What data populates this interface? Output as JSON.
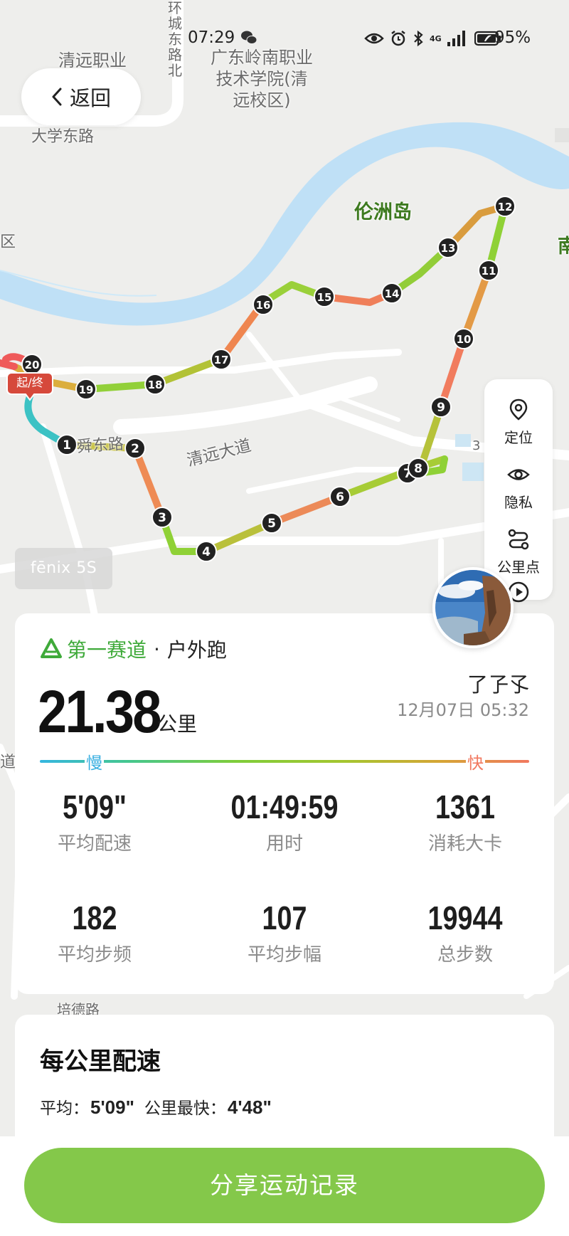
{
  "status_bar": {
    "time": "07:29",
    "battery": "95%",
    "network": "4G"
  },
  "map": {
    "labels": {
      "school_a": "清远职业",
      "school_b": "广东岭南职业\n技术学院(清\n远校区)",
      "road_huancheng": "环\n城\n东\n路\n北",
      "road_daxue": "大学东路",
      "island": "伦洲岛",
      "edge_right": "南",
      "road_qingyuan": "清远大道",
      "road_left": "区",
      "road_left2": "道",
      "road_small": "3",
      "road_bottom": "培德路",
      "road_frag": "舜东路"
    },
    "km_markers": [
      "1",
      "2",
      "3",
      "4",
      "5",
      "6",
      "7",
      "8",
      "9",
      "10",
      "11",
      "12",
      "13",
      "14",
      "15",
      "16",
      "17",
      "18",
      "19",
      "20"
    ],
    "start_end_label": "起/终",
    "device": "fēnix 5S"
  },
  "back_button": {
    "label": "返回"
  },
  "toolbar": {
    "locate": "定位",
    "privacy": "隐私",
    "km_points": "公里点"
  },
  "summary": {
    "brand": "第一赛道",
    "separator": "·",
    "activity": "户外跑",
    "distance": "21.38",
    "distance_unit": "公里",
    "user": "了孒孓",
    "datetime": "12月07日 05:32",
    "pace_slow": "慢",
    "pace_fast": "快",
    "stats": [
      {
        "value": "5'09\"",
        "label": "平均配速"
      },
      {
        "value": "01:49:59",
        "label": "用时"
      },
      {
        "value": "1361",
        "label": "消耗大卡"
      },
      {
        "value": "182",
        "label": "平均步频"
      },
      {
        "value": "107",
        "label": "平均步幅"
      },
      {
        "value": "19944",
        "label": "总步数"
      }
    ]
  },
  "pace_card": {
    "title": "每公里配速",
    "avg_label": "平均：",
    "avg_value": "5'09\"",
    "fastest_label": "公里最快：",
    "fastest_value": "4'48\""
  },
  "share": {
    "label": "分享运动记录"
  },
  "colors": {
    "accent": "#84c84a",
    "brand": "#3faa3a",
    "slow": "#36aee0",
    "fast": "#f1785f",
    "river": "#bfe0f6"
  }
}
